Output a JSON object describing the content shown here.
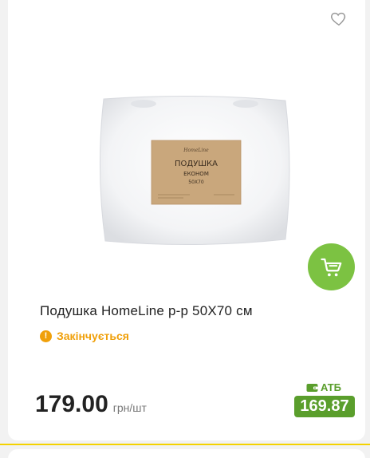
{
  "product": {
    "title": "Подушка HomeLine р-р 50Х70 см",
    "status": "Закінчується",
    "price": "179.00",
    "unit": "грн/шт",
    "store_label": "АТБ",
    "store_price": "169.87",
    "package_label": {
      "brand": "HomeLine",
      "name": "ПОДУШКА",
      "type": "ЕКОНОМ",
      "size": "50Х70"
    }
  },
  "icons": {
    "favorite": "heart-icon",
    "cart": "cart-icon",
    "status": "exclamation-icon",
    "wallet": "wallet-icon"
  },
  "colors": {
    "accent_green": "#7cc242",
    "dark_green": "#5a9e2c",
    "warning_orange": "#f0a00a",
    "strip_yellow": "#f4d200"
  }
}
